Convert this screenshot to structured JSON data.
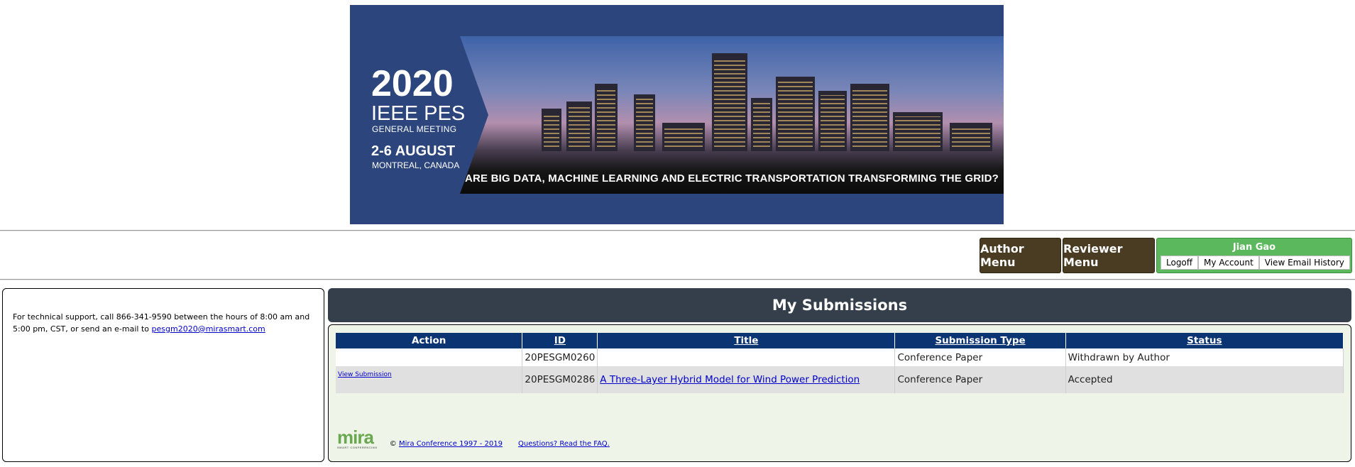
{
  "banner": {
    "year": "2020",
    "org": "IEEE PES",
    "meeting": "GENERAL MEETING",
    "dates": "2-6 AUGUST",
    "city": "MONTREAL, CANADA",
    "caption": "ARE BIG DATA, MACHINE LEARNING AND ELECTRIC TRANSPORTATION TRANSFORMING THE GRID?"
  },
  "menu": {
    "author": "Author Menu",
    "reviewer": "Reviewer Menu"
  },
  "user": {
    "name": "Jian Gao",
    "logoff": "Logoff",
    "account": "My Account",
    "email_history": "View Email History"
  },
  "support": {
    "text": "For technical support, call 866-341-9590 between the hours of 8:00 am and 5:00 pm, CST, or send an e-mail to ",
    "email": "pesgm2020@mirasmart.com"
  },
  "page": {
    "title": "My Submissions"
  },
  "table": {
    "headers": [
      "Action",
      "ID",
      "Title",
      "Submission Type",
      "Status"
    ],
    "rows": [
      {
        "action": "",
        "id": "20PESGM0260",
        "title": "",
        "type": "Conference Paper",
        "status": "Withdrawn by Author"
      },
      {
        "action": "View Submission",
        "id": "20PESGM0286",
        "title": "A Three-Layer Hybrid Model for Wind Power Prediction",
        "type": "Conference Paper",
        "status": "Accepted"
      }
    ]
  },
  "footer": {
    "logo": "mira",
    "logo_sub": "SMART CONFERENCING",
    "copyright_symbol": "©",
    "copyright_link": "Mira Conference 1997 - 2019",
    "faq": "Questions? Read the FAQ."
  },
  "colors": {
    "banner_bg": "#2c457c",
    "menu_bg": "#4a3c23",
    "user_bg": "#5cb85c",
    "header_bar": "#343f4b",
    "table_header": "#0b3473",
    "accepted": "#2e8b2e"
  }
}
